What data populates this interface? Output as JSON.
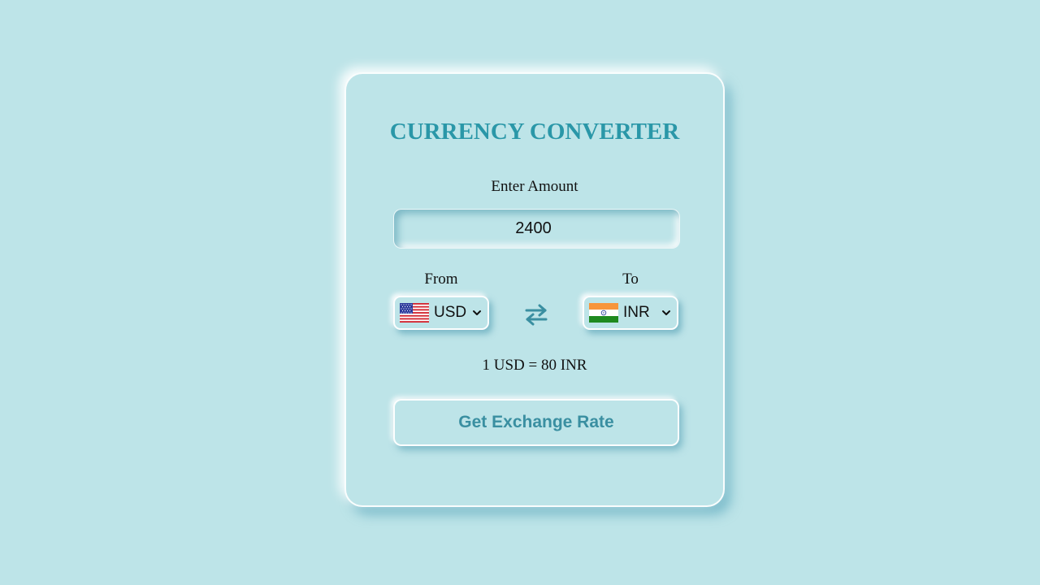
{
  "converter": {
    "title": "CURRENCY CONVERTER",
    "amount_label": "Enter Amount",
    "amount_value": "2400",
    "from_label": "From",
    "to_label": "To",
    "from_currency": "USD",
    "to_currency": "INR",
    "from_flag": "us-flag",
    "to_flag": "india-flag",
    "swap_icon": "swap-arrows-icon",
    "rate_text": "1 USD = 80 INR",
    "button_label": "Get Exchange Rate"
  },
  "colors": {
    "background": "#bde4e8",
    "title": "#2a97a8",
    "button_text": "#3a8fa1",
    "swap_icon": "#3a8fa1"
  }
}
